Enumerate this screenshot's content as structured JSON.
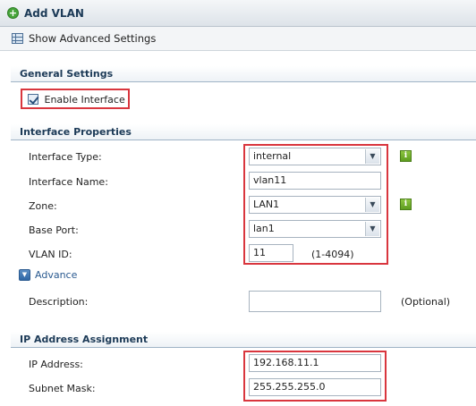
{
  "window": {
    "title": "Add VLAN"
  },
  "toolbar": {
    "advanced_label": "Show Advanced Settings"
  },
  "general": {
    "header": "General Settings",
    "enable_label": "Enable Interface",
    "enable_checked": true
  },
  "interface_props": {
    "header": "Interface Properties",
    "type_label": "Interface Type:",
    "type_value": "internal",
    "name_label": "Interface Name:",
    "name_value": "vlan11",
    "zone_label": "Zone:",
    "zone_value": "LAN1",
    "base_port_label": "Base Port:",
    "base_port_value": "lan1",
    "vlan_id_label": "VLAN ID:",
    "vlan_id_value": "11",
    "vlan_id_range": "(1-4094)",
    "advance_label": "Advance",
    "description_label": "Description:",
    "description_value": "",
    "description_hint": "(Optional)"
  },
  "ip_assignment": {
    "header": "IP Address Assignment",
    "ip_label": "IP Address:",
    "ip_value": "192.168.11.1",
    "mask_label": "Subnet Mask:",
    "mask_value": "255.255.255.0"
  },
  "colors": {
    "highlight": "#d9363e",
    "header_text": "#1c3a57",
    "info_green": "#6aa826"
  },
  "icons": {
    "add": "add-circle-icon",
    "advanced": "table-icon",
    "info": "info-icon",
    "advance": "chevron-down-icon"
  }
}
